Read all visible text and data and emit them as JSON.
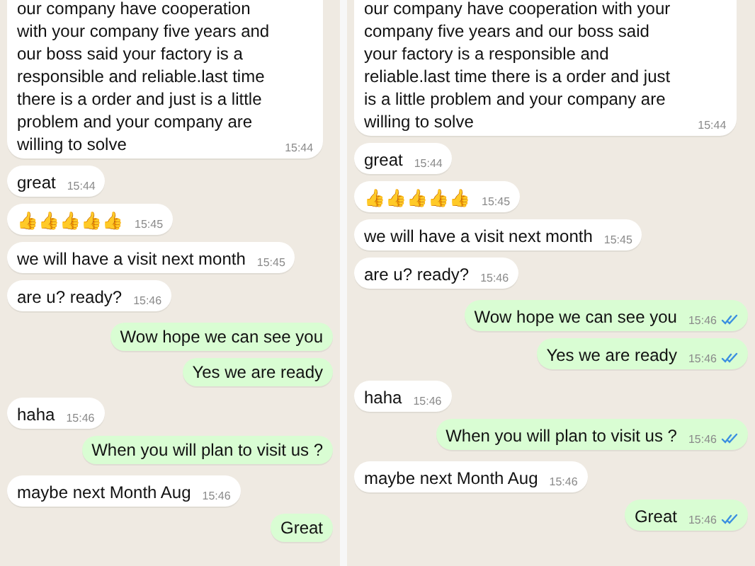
{
  "panels": [
    {
      "messages": [
        {
          "kind": "in",
          "text": "our company have cooperation with your company five years and our boss said your factory is a responsible and reliable.last time there is a order and just is  a little problem and your company are willing to solve",
          "time": "15:44"
        },
        {
          "kind": "in",
          "text": "great",
          "time": "15:44"
        },
        {
          "kind": "in",
          "text": "👍👍👍👍👍",
          "time": "15:45"
        },
        {
          "kind": "in",
          "text": "we will have a visit next month",
          "time": "15:45"
        },
        {
          "kind": "in",
          "text": "are u? ready?",
          "time": "15:46"
        },
        {
          "kind": "out",
          "text": "Wow hope we can see you"
        },
        {
          "kind": "out",
          "text": "Yes we are ready"
        },
        {
          "kind": "in",
          "text": "haha",
          "time": "15:46"
        },
        {
          "kind": "out",
          "text": "When you will plan to visit us ?"
        },
        {
          "kind": "in",
          "text": "maybe next Month Aug",
          "time": "15:46"
        },
        {
          "kind": "out",
          "text": "Great"
        }
      ]
    },
    {
      "messages": [
        {
          "kind": "in",
          "text": "our company have cooperation with your company five years and our boss said your factory is a responsible and reliable.last time there is a order and just is  a little problem and your company are willing to solve",
          "time": "15:44"
        },
        {
          "kind": "in",
          "text": "great",
          "time": "15:44"
        },
        {
          "kind": "in",
          "text": "👍👍👍👍👍",
          "time": "15:45"
        },
        {
          "kind": "in",
          "text": "we will have a visit next month",
          "time": "15:45"
        },
        {
          "kind": "in",
          "text": "are u? ready?",
          "time": "15:46"
        },
        {
          "kind": "out",
          "text": "Wow hope we can see you",
          "time": "15:46",
          "read": true
        },
        {
          "kind": "out",
          "text": "Yes we are ready",
          "time": "15:46",
          "read": true
        },
        {
          "kind": "in",
          "text": "haha",
          "time": "15:46"
        },
        {
          "kind": "out",
          "text": "When you will plan to visit us ?",
          "time": "15:46",
          "read": true
        },
        {
          "kind": "in",
          "text": "maybe next Month Aug",
          "time": "15:46"
        },
        {
          "kind": "out",
          "text": "Great",
          "time": "15:46",
          "read": true
        }
      ]
    }
  ]
}
